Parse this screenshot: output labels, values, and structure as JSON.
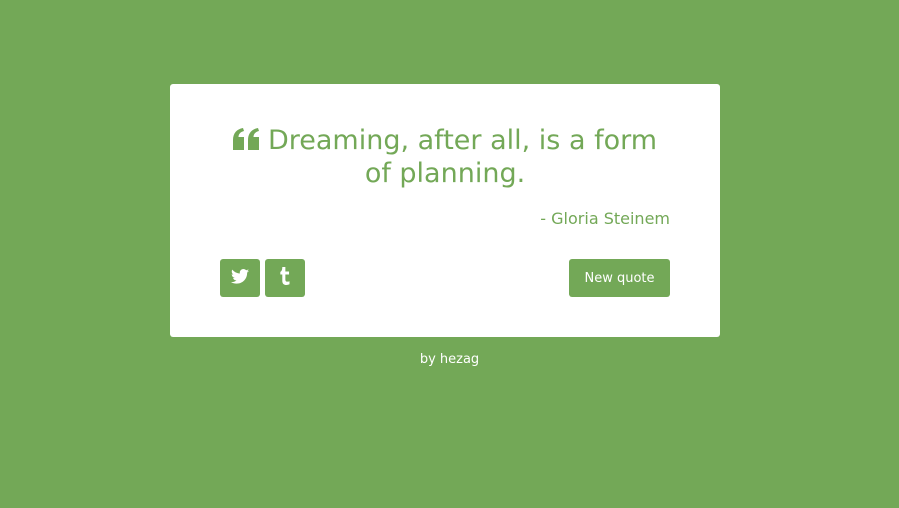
{
  "colors": {
    "background": "#73a857",
    "card": "#ffffff",
    "accent": "#73a857",
    "button_text": "#ffffff"
  },
  "quote_box": {
    "quote_icon": "quote-left-icon",
    "text": "Dreaming, after all, is a form of planning.",
    "author": "- Gloria Steinem"
  },
  "actions": {
    "twitter_icon": "twitter-icon",
    "tumblr_icon": "tumblr-icon",
    "new_quote_label": "New quote"
  },
  "footer": {
    "prefix": "by",
    "author_link": "hezag"
  }
}
